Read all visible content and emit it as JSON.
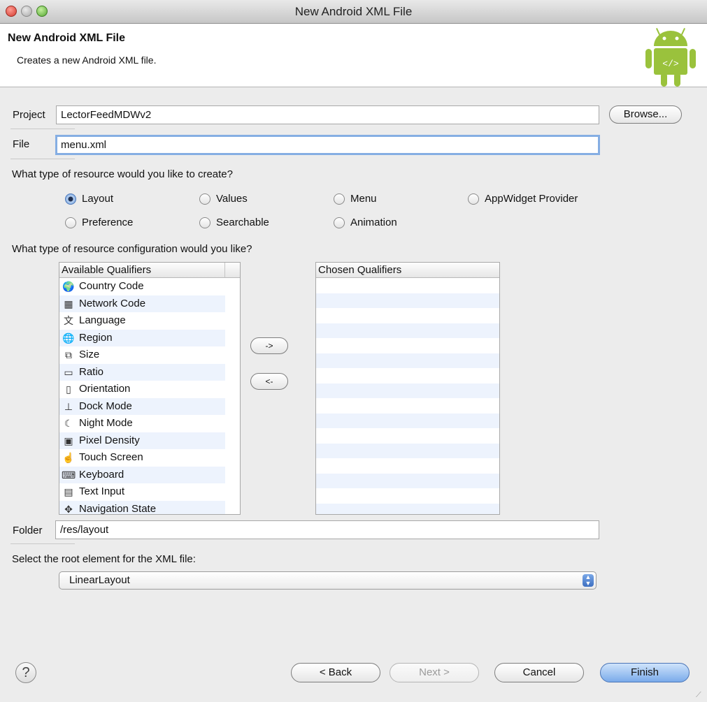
{
  "window": {
    "title": "New Android XML File"
  },
  "banner": {
    "title": "New Android XML File",
    "description": "Creates a new Android XML file.",
    "logo_icon": "android-robot-icon",
    "logo_color": "#9ac23c"
  },
  "project": {
    "label": "Project",
    "value": "LectorFeedMDWv2",
    "browse_label": "Browse..."
  },
  "file": {
    "label": "File",
    "value": "menu.xml"
  },
  "resource_type": {
    "question": "What type of resource would you like to create?",
    "selected": "Layout",
    "options": [
      "Layout",
      "Values",
      "Menu",
      "AppWidget Provider",
      "Preference",
      "Searchable",
      "Animation"
    ]
  },
  "configuration": {
    "question": "What type of resource configuration would you like?",
    "available_header": "Available Qualifiers",
    "chosen_header": "Chosen Qualifiers",
    "add_label": "->",
    "remove_label": "<-",
    "available": [
      {
        "label": "Country Code",
        "icon": "globe-icon"
      },
      {
        "label": "Network Code",
        "icon": "network-icon"
      },
      {
        "label": "Language",
        "icon": "language-icon"
      },
      {
        "label": "Region",
        "icon": "region-icon"
      },
      {
        "label": "Size",
        "icon": "size-icon"
      },
      {
        "label": "Ratio",
        "icon": "ratio-icon"
      },
      {
        "label": "Orientation",
        "icon": "orientation-icon"
      },
      {
        "label": "Dock Mode",
        "icon": "dock-icon"
      },
      {
        "label": "Night Mode",
        "icon": "night-mode-icon"
      },
      {
        "label": "Pixel Density",
        "icon": "dpi-icon"
      },
      {
        "label": "Touch Screen",
        "icon": "touch-icon"
      },
      {
        "label": "Keyboard",
        "icon": "keyboard-icon"
      },
      {
        "label": "Text Input",
        "icon": "text-input-icon"
      },
      {
        "label": "Navigation State",
        "icon": "navigation-icon"
      }
    ],
    "chosen": []
  },
  "folder": {
    "label": "Folder",
    "value": "/res/layout"
  },
  "root_element": {
    "question": "Select the root element for the XML file:",
    "value": "LinearLayout"
  },
  "footer": {
    "help_label": "?",
    "back_label": "< Back",
    "next_label": "Next >",
    "cancel_label": "Cancel",
    "finish_label": "Finish"
  }
}
